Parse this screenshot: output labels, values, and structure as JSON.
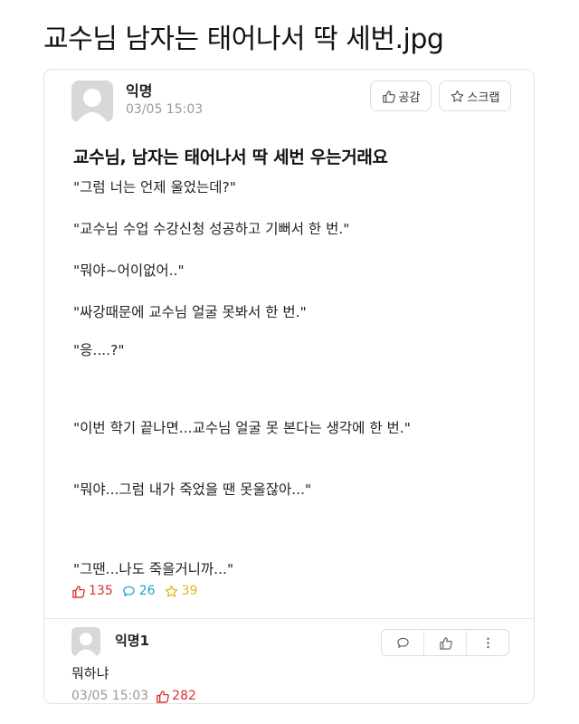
{
  "page": {
    "title": "교수님 남자는 태어나서 딱 세번.jpg"
  },
  "post": {
    "author": "익명",
    "date": "03/05 15:03",
    "like_label": "공감",
    "scrap_label": "스크랩",
    "title": "교수님, 남자는 태어나서 딱 세번 우는거래요",
    "lines": [
      "\"그럼 너는 언제 울었는데?\"",
      "\"교수님 수업 수강신청 성공하고 기뻐서 한 번.\"",
      "\"뭐야~어이없어..\"",
      "\"싸강때문에 교수님 얼굴 못봐서 한 번.\"",
      "\"응....?\"",
      "\"이번 학기 끝나면...교수님 얼굴 못 본다는 생각에 한 번.\"",
      "\"뭐야...그럼 내가 죽었을 땐 못울잖아...\"",
      "\"그땐...나도 죽을거니까...\""
    ],
    "stats": {
      "likes": "135",
      "comments": "26",
      "scraps": "39"
    }
  },
  "comment": {
    "author": "익명1",
    "text": "뭐하냐",
    "date": "03/05 15:03",
    "likes": "282"
  },
  "colors": {
    "like": "#d7322e",
    "comment": "#18a5c9",
    "scrap": "#e5b520"
  }
}
